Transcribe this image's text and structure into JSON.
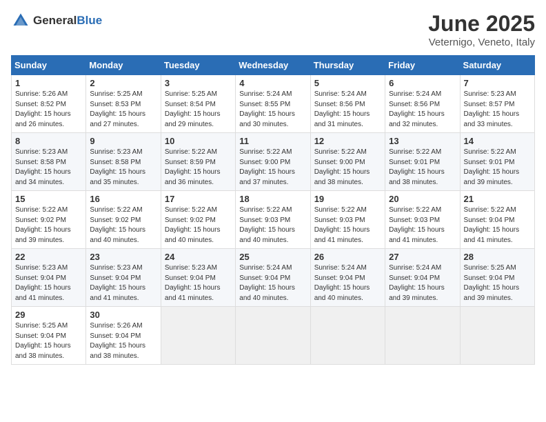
{
  "logo": {
    "text_general": "General",
    "text_blue": "Blue"
  },
  "title": "June 2025",
  "location": "Veternigo, Veneto, Italy",
  "days_header": [
    "Sunday",
    "Monday",
    "Tuesday",
    "Wednesday",
    "Thursday",
    "Friday",
    "Saturday"
  ],
  "weeks": [
    [
      {
        "day": "1",
        "sunrise": "Sunrise: 5:26 AM",
        "sunset": "Sunset: 8:52 PM",
        "daylight": "Daylight: 15 hours and 26 minutes."
      },
      {
        "day": "2",
        "sunrise": "Sunrise: 5:25 AM",
        "sunset": "Sunset: 8:53 PM",
        "daylight": "Daylight: 15 hours and 27 minutes."
      },
      {
        "day": "3",
        "sunrise": "Sunrise: 5:25 AM",
        "sunset": "Sunset: 8:54 PM",
        "daylight": "Daylight: 15 hours and 29 minutes."
      },
      {
        "day": "4",
        "sunrise": "Sunrise: 5:24 AM",
        "sunset": "Sunset: 8:55 PM",
        "daylight": "Daylight: 15 hours and 30 minutes."
      },
      {
        "day": "5",
        "sunrise": "Sunrise: 5:24 AM",
        "sunset": "Sunset: 8:56 PM",
        "daylight": "Daylight: 15 hours and 31 minutes."
      },
      {
        "day": "6",
        "sunrise": "Sunrise: 5:24 AM",
        "sunset": "Sunset: 8:56 PM",
        "daylight": "Daylight: 15 hours and 32 minutes."
      },
      {
        "day": "7",
        "sunrise": "Sunrise: 5:23 AM",
        "sunset": "Sunset: 8:57 PM",
        "daylight": "Daylight: 15 hours and 33 minutes."
      }
    ],
    [
      {
        "day": "8",
        "sunrise": "Sunrise: 5:23 AM",
        "sunset": "Sunset: 8:58 PM",
        "daylight": "Daylight: 15 hours and 34 minutes."
      },
      {
        "day": "9",
        "sunrise": "Sunrise: 5:23 AM",
        "sunset": "Sunset: 8:58 PM",
        "daylight": "Daylight: 15 hours and 35 minutes."
      },
      {
        "day": "10",
        "sunrise": "Sunrise: 5:22 AM",
        "sunset": "Sunset: 8:59 PM",
        "daylight": "Daylight: 15 hours and 36 minutes."
      },
      {
        "day": "11",
        "sunrise": "Sunrise: 5:22 AM",
        "sunset": "Sunset: 9:00 PM",
        "daylight": "Daylight: 15 hours and 37 minutes."
      },
      {
        "day": "12",
        "sunrise": "Sunrise: 5:22 AM",
        "sunset": "Sunset: 9:00 PM",
        "daylight": "Daylight: 15 hours and 38 minutes."
      },
      {
        "day": "13",
        "sunrise": "Sunrise: 5:22 AM",
        "sunset": "Sunset: 9:01 PM",
        "daylight": "Daylight: 15 hours and 38 minutes."
      },
      {
        "day": "14",
        "sunrise": "Sunrise: 5:22 AM",
        "sunset": "Sunset: 9:01 PM",
        "daylight": "Daylight: 15 hours and 39 minutes."
      }
    ],
    [
      {
        "day": "15",
        "sunrise": "Sunrise: 5:22 AM",
        "sunset": "Sunset: 9:02 PM",
        "daylight": "Daylight: 15 hours and 39 minutes."
      },
      {
        "day": "16",
        "sunrise": "Sunrise: 5:22 AM",
        "sunset": "Sunset: 9:02 PM",
        "daylight": "Daylight: 15 hours and 40 minutes."
      },
      {
        "day": "17",
        "sunrise": "Sunrise: 5:22 AM",
        "sunset": "Sunset: 9:02 PM",
        "daylight": "Daylight: 15 hours and 40 minutes."
      },
      {
        "day": "18",
        "sunrise": "Sunrise: 5:22 AM",
        "sunset": "Sunset: 9:03 PM",
        "daylight": "Daylight: 15 hours and 40 minutes."
      },
      {
        "day": "19",
        "sunrise": "Sunrise: 5:22 AM",
        "sunset": "Sunset: 9:03 PM",
        "daylight": "Daylight: 15 hours and 41 minutes."
      },
      {
        "day": "20",
        "sunrise": "Sunrise: 5:22 AM",
        "sunset": "Sunset: 9:03 PM",
        "daylight": "Daylight: 15 hours and 41 minutes."
      },
      {
        "day": "21",
        "sunrise": "Sunrise: 5:22 AM",
        "sunset": "Sunset: 9:04 PM",
        "daylight": "Daylight: 15 hours and 41 minutes."
      }
    ],
    [
      {
        "day": "22",
        "sunrise": "Sunrise: 5:23 AM",
        "sunset": "Sunset: 9:04 PM",
        "daylight": "Daylight: 15 hours and 41 minutes."
      },
      {
        "day": "23",
        "sunrise": "Sunrise: 5:23 AM",
        "sunset": "Sunset: 9:04 PM",
        "daylight": "Daylight: 15 hours and 41 minutes."
      },
      {
        "day": "24",
        "sunrise": "Sunrise: 5:23 AM",
        "sunset": "Sunset: 9:04 PM",
        "daylight": "Daylight: 15 hours and 41 minutes."
      },
      {
        "day": "25",
        "sunrise": "Sunrise: 5:24 AM",
        "sunset": "Sunset: 9:04 PM",
        "daylight": "Daylight: 15 hours and 40 minutes."
      },
      {
        "day": "26",
        "sunrise": "Sunrise: 5:24 AM",
        "sunset": "Sunset: 9:04 PM",
        "daylight": "Daylight: 15 hours and 40 minutes."
      },
      {
        "day": "27",
        "sunrise": "Sunrise: 5:24 AM",
        "sunset": "Sunset: 9:04 PM",
        "daylight": "Daylight: 15 hours and 39 minutes."
      },
      {
        "day": "28",
        "sunrise": "Sunrise: 5:25 AM",
        "sunset": "Sunset: 9:04 PM",
        "daylight": "Daylight: 15 hours and 39 minutes."
      }
    ],
    [
      {
        "day": "29",
        "sunrise": "Sunrise: 5:25 AM",
        "sunset": "Sunset: 9:04 PM",
        "daylight": "Daylight: 15 hours and 38 minutes."
      },
      {
        "day": "30",
        "sunrise": "Sunrise: 5:26 AM",
        "sunset": "Sunset: 9:04 PM",
        "daylight": "Daylight: 15 hours and 38 minutes."
      },
      null,
      null,
      null,
      null,
      null
    ]
  ]
}
